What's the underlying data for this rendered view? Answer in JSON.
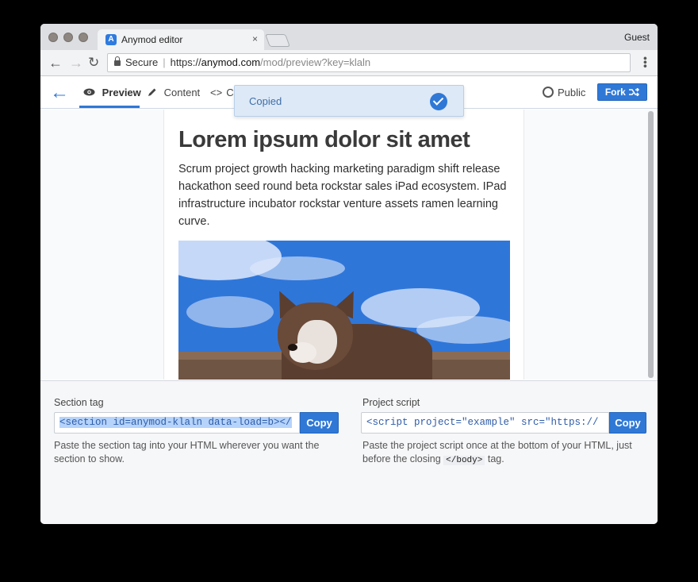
{
  "browser": {
    "tab_title": "Anymod editor",
    "tab_favicon": "A",
    "tab_close": "×",
    "profile": "Guest",
    "secure_label": "Secure",
    "url_scheme": "https://",
    "url_host": "anymod.com",
    "url_path": "/mod/preview?key=klaln"
  },
  "appnav": {
    "tabs": [
      {
        "label": "Preview",
        "icon": "eye-icon"
      },
      {
        "label": "Content",
        "icon": "pencil-icon"
      },
      {
        "label": "Co",
        "icon": "code-icon"
      }
    ],
    "public_label": "Public",
    "fork_label": "Fork"
  },
  "toast": {
    "text": "Copied"
  },
  "preview": {
    "heading": "Lorem ipsum dolor sit amet",
    "paragraph": "Scrum project growth hacking marketing paradigm shift release hackathon seed round beta rockstar sales iPad ecosystem. IPad infrastructure incubator rockstar venture assets ramen learning curve."
  },
  "section_tag": {
    "label": "Section tag",
    "code": "<section id=anymod-klaln data-load=b></",
    "copy_label": "Copy",
    "help": "Paste the section tag into your HTML wherever you want the section to show."
  },
  "project_script": {
    "label": "Project script",
    "code": "<script project=\"example\" src=\"https://",
    "copy_label": "Copy",
    "help_before": "Paste the project script once at the bottom of your HTML, just before the closing ",
    "help_code": "</body>",
    "help_after": " tag."
  },
  "colors": {
    "accent": "#2f78d6",
    "toast_bg": "#dde9f7"
  }
}
